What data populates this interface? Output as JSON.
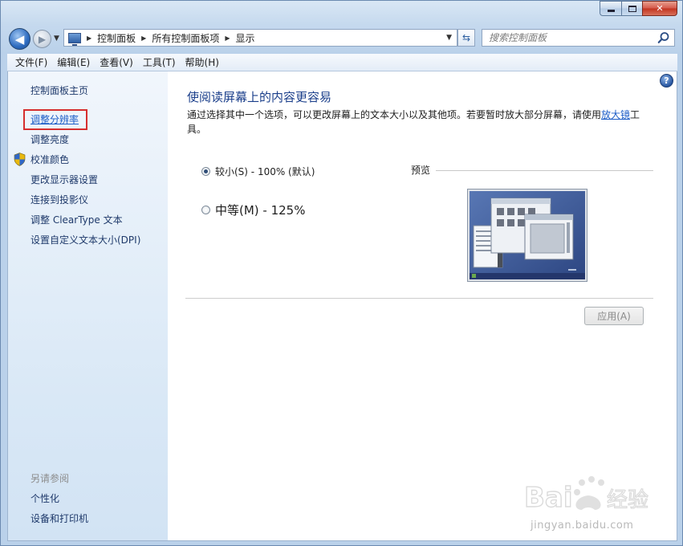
{
  "nav": {
    "breadcrumb": [
      "控制面板",
      "所有控制面板项",
      "显示"
    ],
    "search_placeholder": "搜索控制面板"
  },
  "menu": [
    "文件(F)",
    "编辑(E)",
    "查看(V)",
    "工具(T)",
    "帮助(H)"
  ],
  "sidebar": {
    "items": [
      "控制面板主页",
      "调整分辨率",
      "调整亮度",
      "校准颜色",
      "更改显示器设置",
      "连接到投影仪",
      "调整 ClearType 文本",
      "设置自定义文本大小(DPI)"
    ],
    "see_also_heading": "另请参阅",
    "see_also": [
      "个性化",
      "设备和打印机"
    ]
  },
  "main": {
    "title": "使阅读屏幕上的内容更容易",
    "description_pre": "通过选择其中一个选项，可以更改屏幕上的文本大小以及其他项。若要暂时放大部分屏幕，请使用",
    "description_link": "放大镜",
    "description_post": "工具。",
    "option_small": "较小(S) - 100% (默认)",
    "option_medium": "中等(M) - 125%",
    "preview_label": "预览",
    "apply_label": "应用(A)"
  },
  "help_symbol": "?",
  "watermark": {
    "logo_text": "Bai 经验",
    "url": "jingyan.baidu.com"
  },
  "colors": {
    "link": "#1c5dc7",
    "title": "#1b3f8b",
    "highlight": "#d62e2e"
  }
}
